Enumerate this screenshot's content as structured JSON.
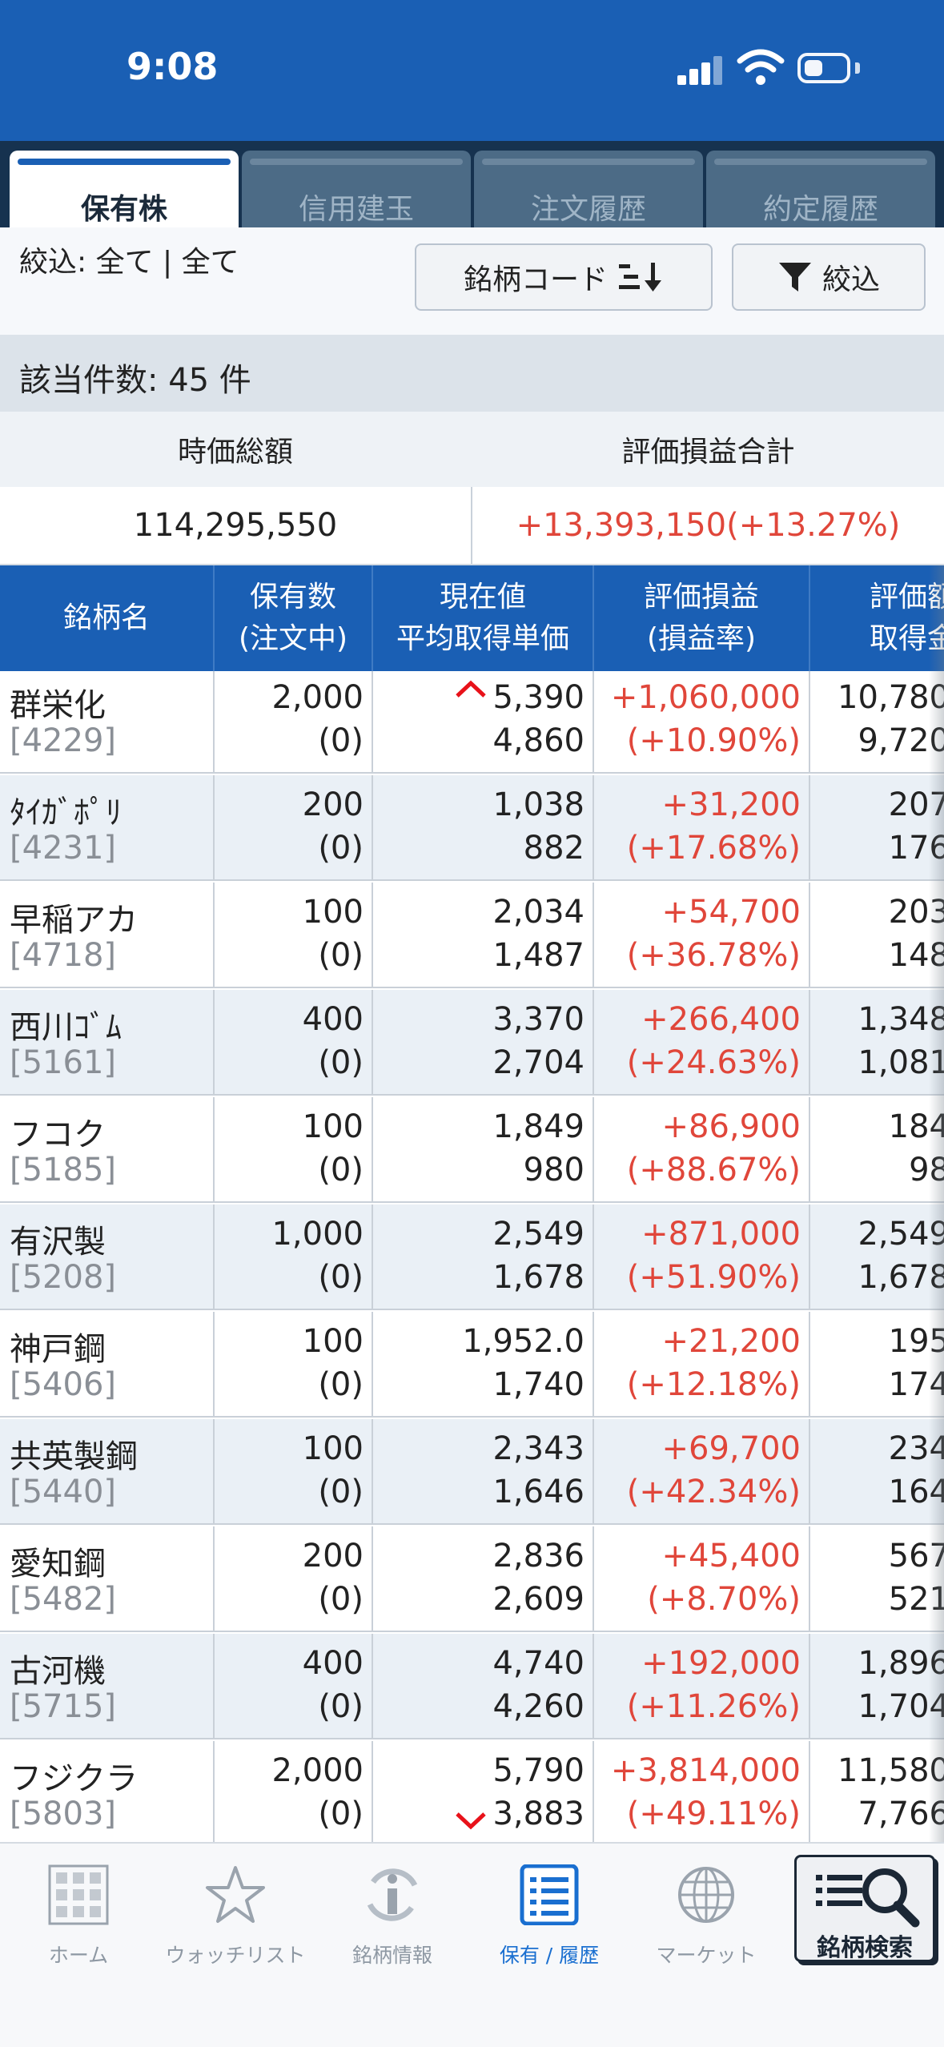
{
  "status_bar": {
    "time": "9:08"
  },
  "tabs": [
    {
      "label": "保有株",
      "active": true
    },
    {
      "label": "信用建玉",
      "active": false
    },
    {
      "label": "注文履歴",
      "active": false
    },
    {
      "label": "約定履歴",
      "active": false
    }
  ],
  "filter": {
    "text": "絞込:  全て | 全て",
    "sort_label": "銘柄コード",
    "filter_label": "絞込"
  },
  "count_text": "該当件数: 45 件",
  "summary": {
    "market_value_label": "時価総額",
    "pl_total_label": "評価損益合計",
    "market_value": "114,295,550",
    "pl_total": "+13,393,150(+13.27%)"
  },
  "table": {
    "headers": [
      {
        "l1": "銘柄名",
        "l2": ""
      },
      {
        "l1": "保有数",
        "l2": "(注文中)"
      },
      {
        "l1": "現在値",
        "l2": "平均取得単価"
      },
      {
        "l1": "評価損益",
        "l2": "(損益率)"
      },
      {
        "l1": "評価額",
        "l2": "取得金"
      }
    ],
    "rows": [
      {
        "name": "群栄化",
        "code": "[4229]",
        "qty": "2,000",
        "pending": "(0)",
        "price": "5,390",
        "avg": "4,860",
        "pl": "+1,060,000",
        "pl_rate": "(+10.90%)",
        "value": "10,780",
        "cost": "9,720"
      },
      {
        "name": "ﾀｲｶﾞﾎﾟﾘ",
        "code": "[4231]",
        "qty": "200",
        "pending": "(0)",
        "price": "1,038",
        "avg": "882",
        "pl": "+31,200",
        "pl_rate": "(+17.68%)",
        "value": "207",
        "cost": "176"
      },
      {
        "name": "早稲アカ",
        "code": "[4718]",
        "qty": "100",
        "pending": "(0)",
        "price": "2,034",
        "avg": "1,487",
        "pl": "+54,700",
        "pl_rate": "(+36.78%)",
        "value": "203",
        "cost": "148"
      },
      {
        "name": "西川ｺﾞﾑ",
        "code": "[5161]",
        "qty": "400",
        "pending": "(0)",
        "price": "3,370",
        "avg": "2,704",
        "pl": "+266,400",
        "pl_rate": "(+24.63%)",
        "value": "1,348",
        "cost": "1,081"
      },
      {
        "name": "フコク",
        "code": "[5185]",
        "qty": "100",
        "pending": "(0)",
        "price": "1,849",
        "avg": "980",
        "pl": "+86,900",
        "pl_rate": "(+88.67%)",
        "value": "184",
        "cost": "98"
      },
      {
        "name": "有沢製",
        "code": "[5208]",
        "qty": "1,000",
        "pending": "(0)",
        "price": "2,549",
        "avg": "1,678",
        "pl": "+871,000",
        "pl_rate": "(+51.90%)",
        "value": "2,549",
        "cost": "1,678"
      },
      {
        "name": "神戸鋼",
        "code": "[5406]",
        "qty": "100",
        "pending": "(0)",
        "price": "1,952.0",
        "avg": "1,740",
        "pl": "+21,200",
        "pl_rate": "(+12.18%)",
        "value": "195",
        "cost": "174"
      },
      {
        "name": "共英製鋼",
        "code": "[5440]",
        "qty": "100",
        "pending": "(0)",
        "price": "2,343",
        "avg": "1,646",
        "pl": "+69,700",
        "pl_rate": "(+42.34%)",
        "value": "234",
        "cost": "164"
      },
      {
        "name": "愛知鋼",
        "code": "[5482]",
        "qty": "200",
        "pending": "(0)",
        "price": "2,836",
        "avg": "2,609",
        "pl": "+45,400",
        "pl_rate": "(+8.70%)",
        "value": "567",
        "cost": "521"
      },
      {
        "name": "古河機",
        "code": "[5715]",
        "qty": "400",
        "pending": "(0)",
        "price": "4,740",
        "avg": "4,260",
        "pl": "+192,000",
        "pl_rate": "(+11.26%)",
        "value": "1,896",
        "cost": "1,704"
      },
      {
        "name": "フジクラ",
        "code": "[5803]",
        "qty": "2,000",
        "pending": "(0)",
        "price": "5,790",
        "avg": "3,883",
        "pl": "+3,814,000",
        "pl_rate": "(+49.11%)",
        "value": "11,580",
        "cost": "7,766"
      }
    ]
  },
  "bottom_nav": [
    {
      "label": "ホーム",
      "icon": "home-grid-icon",
      "active": false
    },
    {
      "label": "ウォッチリスト",
      "icon": "star-icon",
      "active": false
    },
    {
      "label": "銘柄情報",
      "icon": "info-refresh-icon",
      "active": false
    },
    {
      "label": "保有 / 履歴",
      "icon": "list-document-icon",
      "active": true
    },
    {
      "label": "マーケット",
      "icon": "globe-icon",
      "active": false
    }
  ],
  "search_button": {
    "label": "銘柄検索",
    "icon": "magnifier-list-icon"
  },
  "colors": {
    "brand_blue": "#1a5fb4",
    "tab_bar_dark": "#16324f",
    "gain_red": "#e0463a",
    "nav_active": "#1a6fd0"
  }
}
